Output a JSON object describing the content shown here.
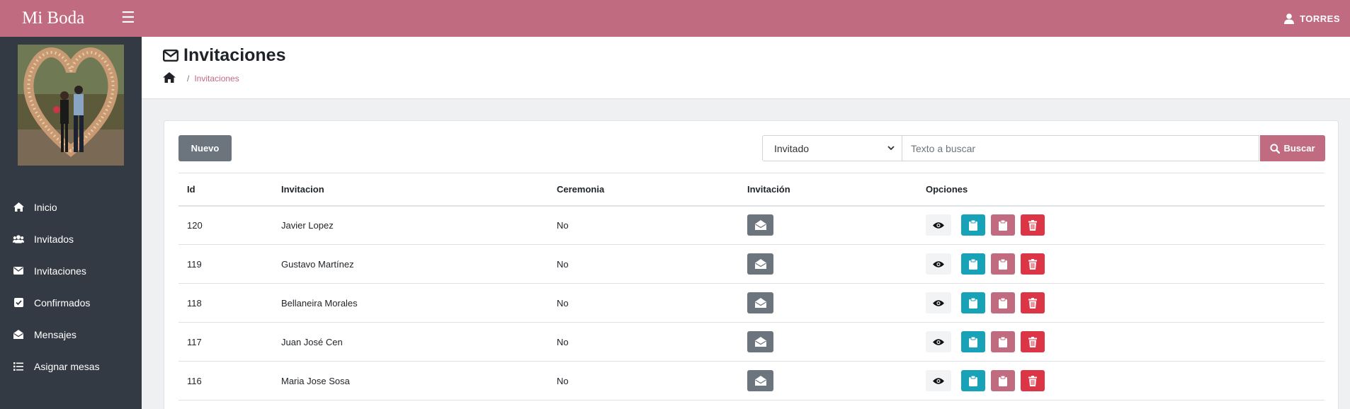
{
  "app": {
    "brand": "Mi Boda",
    "user": "TORRES"
  },
  "sidebar": {
    "items": [
      {
        "label": "Inicio",
        "icon": "home-icon"
      },
      {
        "label": "Invitados",
        "icon": "users-icon"
      },
      {
        "label": "Invitaciones",
        "icon": "envelope-icon"
      },
      {
        "label": "Confirmados",
        "icon": "check-square-icon"
      },
      {
        "label": "Mensajes",
        "icon": "envelope-open-icon"
      },
      {
        "label": "Asignar mesas",
        "icon": "list-icon"
      }
    ]
  },
  "header": {
    "title": "Invitaciones",
    "breadcrumb_sep": "/",
    "breadcrumb_active": "Invitaciones"
  },
  "toolbar": {
    "new_label": "Nuevo",
    "filter_selected": "Invitado",
    "search_placeholder": "Texto a buscar",
    "search_label": "Buscar"
  },
  "table": {
    "headers": [
      "Id",
      "Invitacion",
      "Ceremonia",
      "Invitación",
      "Opciones"
    ],
    "rows": [
      {
        "id": "120",
        "name": "Javier Lopez",
        "ceremonia": "No"
      },
      {
        "id": "119",
        "name": "Gustavo Martínez",
        "ceremonia": "No"
      },
      {
        "id": "118",
        "name": "Bellaneira Morales",
        "ceremonia": "No"
      },
      {
        "id": "117",
        "name": "Juan José Cen",
        "ceremonia": "No"
      },
      {
        "id": "116",
        "name": "Maria Jose Sosa",
        "ceremonia": "No"
      }
    ]
  },
  "colors": {
    "accent": "#c06b80",
    "sidebar": "#343a44",
    "teal": "#17a2b8",
    "danger": "#dc3545",
    "secondary": "#6c757d"
  }
}
